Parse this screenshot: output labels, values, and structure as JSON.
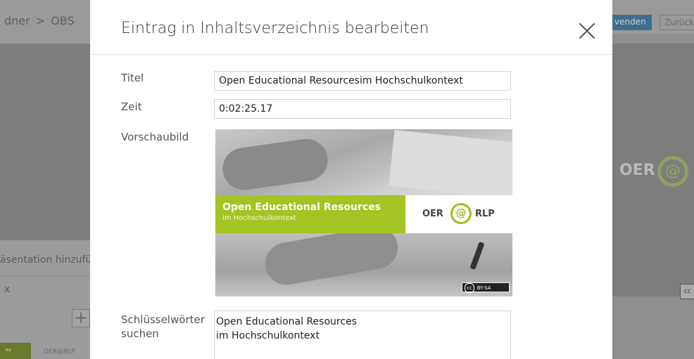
{
  "background": {
    "breadcrumb": {
      "parent": "dner",
      "separator": ">",
      "current": "OBS"
    },
    "left_panel": {
      "add_text": "äsentation hinzufüge",
      "x_text": "x",
      "plus": "+",
      "thumb_label": "es",
      "thumb_logo": "OER@RLP"
    },
    "right_panel": {
      "apply_label": "venden",
      "back_label": "Zurück",
      "oer_text": "OER",
      "at_sign": "@",
      "cc_text": "cc"
    }
  },
  "modal": {
    "title": "Eintrag in Inhaltsverzeichnis bearbeiten",
    "close_icon": "close-icon",
    "fields": {
      "title_label": "Titel",
      "title_value": "Open Educational Resourcesim Hochschulkontext",
      "time_label": "Zeit",
      "time_value": "0:02:25.17",
      "thumbnail_label": "Vorschaubild",
      "keywords_label": "Schlüsselwörter\nsuchen",
      "keywords_value": "Open Educational Resources\nim Hochschulkontext"
    },
    "thumbnail": {
      "headline": "Open Educational Resources",
      "subline": "im Hochschulkontext",
      "logo_oer": "OER",
      "logo_at": "@",
      "logo_rlp": "RLP",
      "license_cc": "cc",
      "license": "BY-SA",
      "accent_color": "#a3c422"
    }
  }
}
